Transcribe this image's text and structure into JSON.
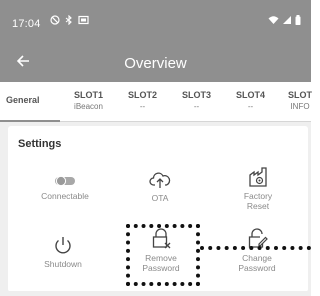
{
  "status_bar": {
    "time": "17:04",
    "left_icons": [
      "do-not-disturb-icon",
      "bluetooth-icon",
      "cast-icon"
    ],
    "right_icons": [
      "wifi-icon",
      "signal-icon",
      "battery-icon"
    ]
  },
  "app_bar": {
    "title": "Overview",
    "back_icon": "arrow-left-icon"
  },
  "tabs": {
    "general": "General",
    "slots": [
      {
        "label": "SLOT1",
        "sub": "iBeacon"
      },
      {
        "label": "SLOT2",
        "sub": "--"
      },
      {
        "label": "SLOT3",
        "sub": "--"
      },
      {
        "label": "SLOT4",
        "sub": "--"
      },
      {
        "label": "SLOT",
        "sub": "INFO"
      }
    ]
  },
  "settings": {
    "title": "Settings",
    "actions": [
      {
        "label": "Connectable",
        "icon": "toggle-icon"
      },
      {
        "label": "OTA",
        "icon": "cloud-upload-icon"
      },
      {
        "label": "Factory\nReset",
        "icon": "factory-reset-icon"
      },
      {
        "label": "Shutdown",
        "icon": "power-icon"
      },
      {
        "label": "Remove\nPassword",
        "icon": "lock-remove-icon"
      },
      {
        "label": "Change\nPassword",
        "icon": "lock-edit-icon"
      }
    ]
  },
  "colors": {
    "bar": "#8f8f8f",
    "muted_text": "#8a8a8a",
    "background": "#efefef"
  }
}
